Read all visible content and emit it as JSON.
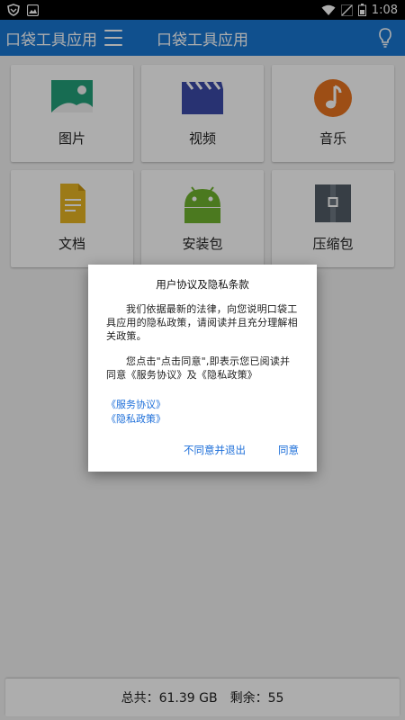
{
  "status_bar": {
    "time": "1:08"
  },
  "app_bar": {
    "app_name": "口袋工具应用",
    "title": "口袋工具应用"
  },
  "tiles": [
    {
      "label": "图片",
      "icon": "image-icon"
    },
    {
      "label": "视频",
      "icon": "video-icon"
    },
    {
      "label": "音乐",
      "icon": "music-icon"
    },
    {
      "label": "文档",
      "icon": "document-icon"
    },
    {
      "label": "安装包",
      "icon": "android-apk-icon"
    },
    {
      "label": "压缩包",
      "icon": "archive-icon"
    }
  ],
  "storage": {
    "total_label": "总共：61.39 GB",
    "free_label": "剩余：55"
  },
  "dialog": {
    "title": "用户协议及隐私条款",
    "paragraph1": "我们依据最新的法律，向您说明口袋工具应用的隐私政策，请阅读并且充分理解相关政策。",
    "paragraph2": "您点击\"点击同意\",即表示您已阅读并同意《服务协议》及《隐私政策》",
    "link_service": "《服务协议》",
    "link_privacy": "《隐私政策》",
    "decline_label": "不同意并退出",
    "agree_label": "同意"
  },
  "colors": {
    "primary": "#1976d2",
    "link": "#1e6fd9"
  }
}
